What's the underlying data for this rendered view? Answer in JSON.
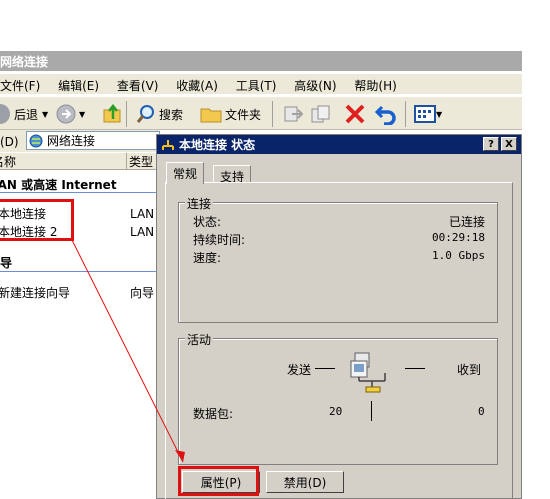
{
  "window": {
    "title": "网络连接",
    "menu": [
      "文件(F)",
      "编辑(E)",
      "查看(V)",
      "收藏(A)",
      "工具(T)",
      "高级(N)",
      "帮助(H)"
    ],
    "toolbar": {
      "back": "后退",
      "search": "搜索",
      "folders": "文件夹"
    },
    "address": {
      "label": "地址(D)",
      "value": "网络连接"
    },
    "columns": {
      "name": "名称",
      "type": "类型"
    },
    "groups": {
      "lan": "LAN 或高速 Internet",
      "wizard": "向导"
    },
    "items": [
      {
        "name": "本地连接",
        "type": "LAN 或高速 Internet"
      },
      {
        "name": "本地连接 2",
        "type": "LAN 或高速 Internet"
      }
    ],
    "wizard_item": {
      "name": "新建连接向导",
      "type": "向导"
    }
  },
  "dialog": {
    "title": "本地连接 状态",
    "help_btn": "?",
    "close_btn": "X",
    "tabs": [
      "常规",
      "支持"
    ],
    "connection": {
      "legend": "连接",
      "status_label": "状态:",
      "status_value": "已连接",
      "duration_label": "持续时间:",
      "duration_value": "00:29:18",
      "speed_label": "速度:",
      "speed_value": "1.0 Gbps"
    },
    "activity": {
      "legend": "活动",
      "sent_label": "发送",
      "received_label": "收到",
      "packets_label": "数据包:",
      "packets_sent": "20",
      "packets_received": "0"
    },
    "buttons": {
      "properties": "属性(P)",
      "disable": "禁用(D)"
    }
  },
  "colors": {
    "annotation": "#e01010",
    "title_active": "#0a246a",
    "title_inactive": "#a9a9a9"
  }
}
